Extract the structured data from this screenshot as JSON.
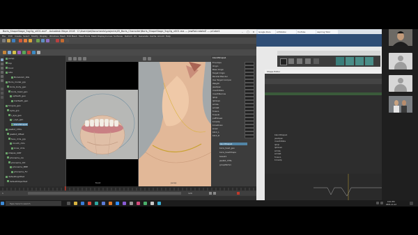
{
  "maya": {
    "title": "Boris_ShapeStage_5qy2g_v001.ma* - Autodesk Maya 2018 · C:\\Users\\ta\\Documents\\projects\\05_Boris_Character\\Boris_ShapeStage_5qy2g_v001.ma --- jawRot.rotateZ --- pCube1",
    "menu": [
      "File",
      "Edit",
      "Create",
      "Select",
      "Modify",
      "Display",
      "Windows",
      "Mesh",
      "Edit Mesh",
      "Mesh Tools",
      "Mesh Display",
      "Curves",
      "Surfaces",
      "Deform",
      "UV",
      "Generate",
      "Cache",
      "Arnold",
      "Help"
    ],
    "outliner_rows": [
      "persp",
      "top",
      "front",
      "side",
      "BorisAnim_RIG",
      "Boris_model_grp",
      "boris_body_geo",
      "boris_head_geo",
      "upTeeth_geo",
      "lowTeeth_geo",
      "tongue_geo",
      "eyes_grp",
      "l_eye_geo",
      "r_eye_geo",
      "blendShape1",
      "jawRot_CTRL",
      "jawRot_Offset",
      "face_ctrls_grp",
      "mouth_ctrls",
      "brow_ctrls",
      "shapes_GRP",
      "phoneme_AA",
      "phoneme_OO",
      "phoneme_MBP",
      "phoneme_FV",
      "defaultLightSet",
      "defaultObjectSet"
    ],
    "selected_row": 14,
    "viewport_left_label": "front",
    "viewport_right_label": "persp",
    "attr_title": "blendShape1",
    "attr_rows": [
      "Envelope",
      "Origin",
      "Base Origin",
      "Target Origin",
      "Parallel Blender",
      "Use Target Compon",
      "Weight",
      "jawOpen",
      "mouthWide",
      "mouthNarrow",
      "lipUp",
      "lipDown",
      "smileL",
      "smileR",
      "frownL",
      "frownR",
      "puffCheek",
      "browUp",
      "browDown",
      "sneer",
      "blink_L",
      "blink_R"
    ],
    "attr_list": [
      "blendShape1",
      "boris_head_geo",
      "boris_headShape",
      "tweak1",
      "jawRot_CTRL",
      "groupParts1"
    ],
    "timeline": {
      "start": "1",
      "end": "120",
      "current": "1"
    }
  },
  "browser": {
    "tabs": [
      "Google Docs",
      "ArtStation",
      "YouTube",
      "Aspiring Tutor"
    ]
  },
  "editor": {
    "title": "Shape Editor",
    "rows": [
      "blendShape1",
      "  jawOpen",
      "  mouthWide",
      "  lipUp",
      "  lipDown",
      "  smileL",
      "  smileR",
      "  frownL",
      "  browUp"
    ]
  },
  "taskbar": {
    "search_placeholder": "Type here to search",
    "time": "9:41 PM",
    "date": "2021-11-12"
  },
  "colors": {
    "maya_bg": "#444444",
    "selection": "#5285a6",
    "browser_strip": "#2f4e76",
    "timeline_red": "#c0392b"
  }
}
